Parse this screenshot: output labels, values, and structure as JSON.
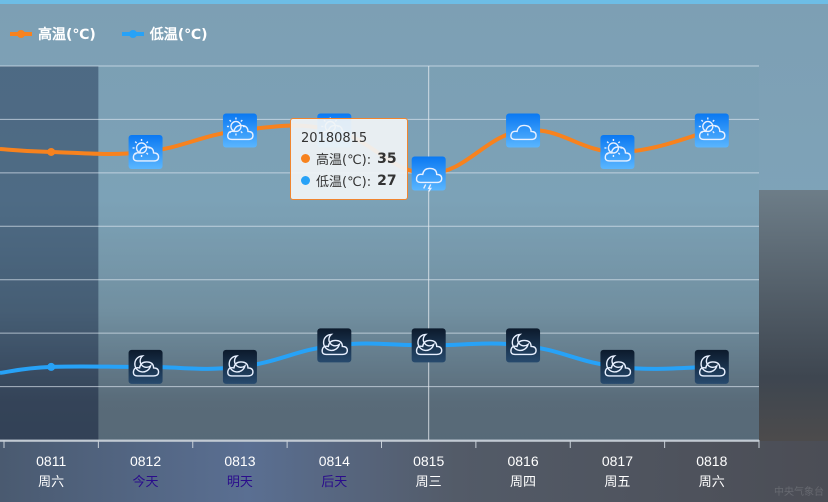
{
  "legend": [
    {
      "label": "高温(℃)",
      "color": "#f7821e"
    },
    {
      "label": "低温(℃)",
      "color": "#27a2f7"
    }
  ],
  "chart_data": {
    "type": "line",
    "categories": [
      "0811",
      "0812",
      "0813",
      "0814",
      "0815",
      "0816",
      "0817",
      "0818"
    ],
    "weekdays": [
      "周六",
      "今天",
      "明天",
      "后天",
      "周三",
      "周四",
      "周五",
      "周六"
    ],
    "series": [
      {
        "name": "高温(℃)",
        "values": [
          36,
          36,
          37,
          37,
          35,
          37,
          36,
          37
        ],
        "icons": [
          "none",
          "sun-cloud",
          "sun-cloud",
          "sun-cloud",
          "thunder-rain",
          "cloud",
          "sun-cloud",
          "sun-cloud"
        ]
      },
      {
        "name": "低温(℃)",
        "values": [
          26,
          26,
          26,
          27,
          27,
          27,
          26,
          26
        ],
        "icons": [
          "none",
          "moon-cloud",
          "moon-cloud",
          "moon-cloud",
          "moon-cloud",
          "moon-cloud",
          "moon-cloud",
          "moon-cloud"
        ]
      }
    ],
    "ylim": [
      22.6,
      40
    ],
    "grid": true,
    "legend_position": "top-left",
    "highlight_weekday_color": "#2a0c8c",
    "past_shaded_category": "0811",
    "crosshair_category": "0815"
  },
  "tooltip": {
    "title": "20180815",
    "rows": [
      {
        "label": "高温(℃):",
        "value": "35",
        "color": "#f7821e"
      },
      {
        "label": "低温(℃):",
        "value": "27",
        "color": "#27a2f7"
      }
    ]
  },
  "watermark": "中央气象台"
}
